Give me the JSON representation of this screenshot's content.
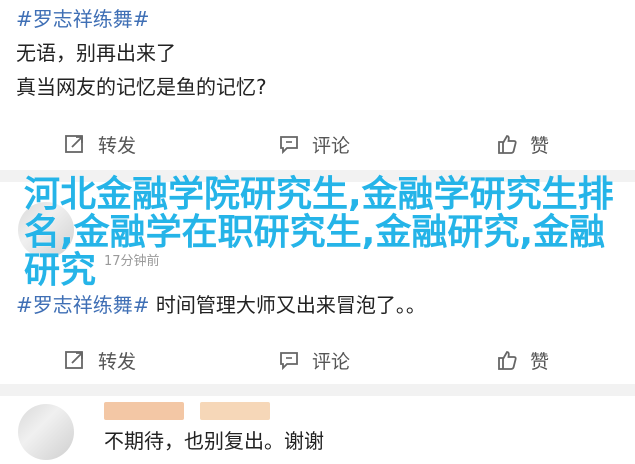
{
  "post1": {
    "hashtag": "#罗志祥练舞#",
    "line1": "无语，别再出来了",
    "line2": "真当网友的记忆是鱼的记忆?"
  },
  "actions": {
    "repost": "转发",
    "comment": "评论",
    "like": "赞"
  },
  "post2": {
    "time": "17分钟前",
    "hashtag": "#罗志祥练舞#",
    "text": " 时间管理大师又出来冒泡了。。"
  },
  "post3": {
    "text": "不期待，也别复出。谢谢"
  },
  "overlay": {
    "title": "河北金融学院研究生,金融学研究生排名,金融学在职研究生,金融研究,金融研究"
  },
  "icons": {
    "repost": "repost-icon",
    "comment": "comment-icon",
    "like": "thumbs-up-icon"
  },
  "colors": {
    "hashtag": "#3f6fb5",
    "overlay": "#25b4e8",
    "action_text": "#555555"
  }
}
